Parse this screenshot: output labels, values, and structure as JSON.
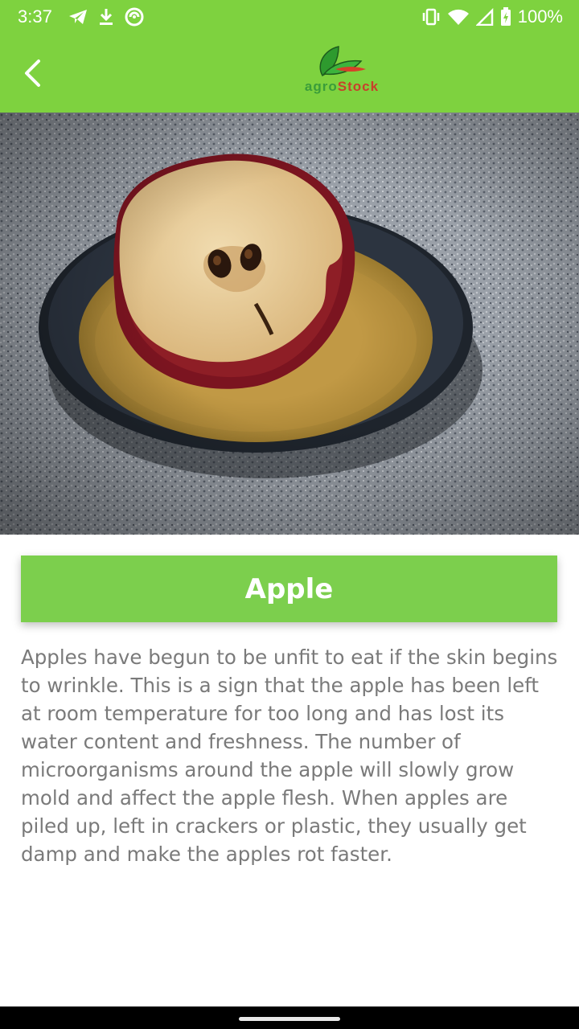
{
  "status_bar": {
    "time": "3:37",
    "battery": "100%",
    "icons_left": [
      "telegram-icon",
      "download-icon",
      "sync-icon"
    ],
    "icons_right": [
      "vibrate-icon",
      "wifi-icon",
      "signal-icon",
      "battery-charging-icon"
    ]
  },
  "app_bar": {
    "back_icon": "chevron-left-icon",
    "logo": {
      "part1": "agro",
      "part2": "Stock"
    },
    "color": "#7ed23f"
  },
  "hero_image": {
    "subject": "dried apple half on a plate"
  },
  "item": {
    "title": "Apple",
    "description": "Apples have begun to be unfit to eat if the skin begins to wrinkle. This is a sign that the apple has been left at room temperature for too long and has lost its water content and freshness. The number of microorganisms around the apple will slowly grow mold and affect the apple flesh. When apples are piled up, left in crackers or plastic, they usually get damp and make the apples rot faster."
  },
  "colors": {
    "accent": "#7ccf4d",
    "text": "#7a7a7a"
  }
}
